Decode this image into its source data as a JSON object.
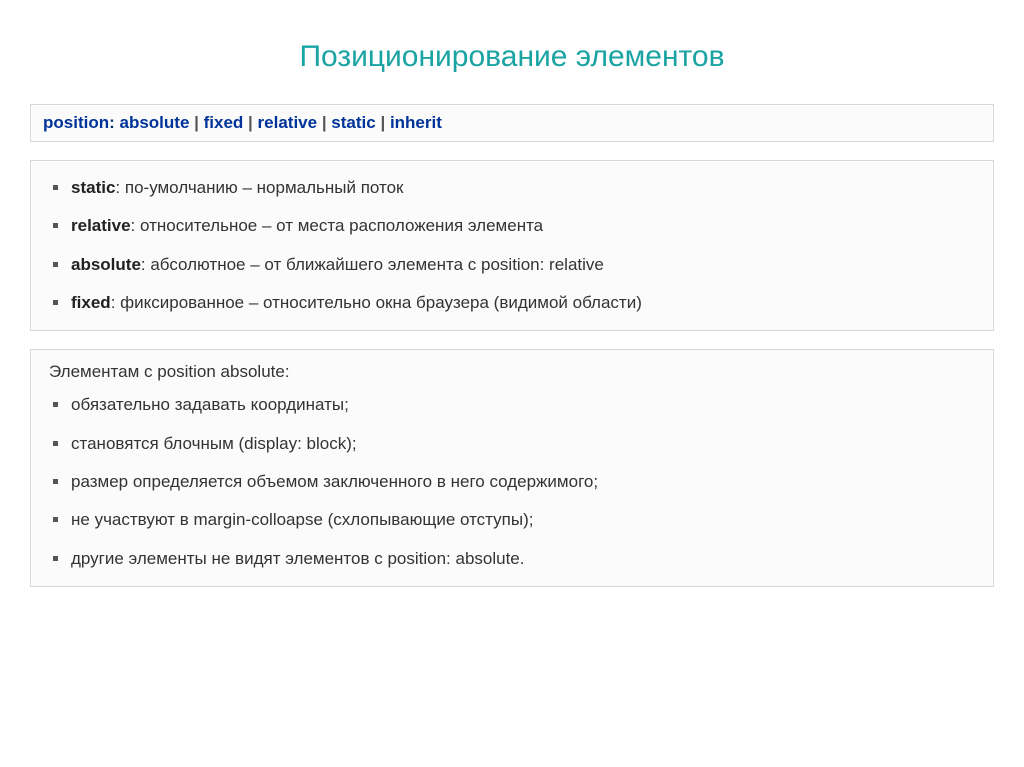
{
  "title": "Позиционирование элементов",
  "syntax": {
    "property": "position",
    "values": [
      "absolute",
      "fixed",
      "relative",
      "static",
      "inherit"
    ]
  },
  "definitions": [
    {
      "term": "static",
      "desc": ": по-умолчанию – нормальный поток"
    },
    {
      "term": "relative",
      "desc": ": относительное – от места расположения элемента"
    },
    {
      "term": "absolute",
      "desc": ": абсолютное – от ближайшего элемента с position: relative"
    },
    {
      "term": "fixed",
      "desc": ": фиксированное – относительно окна браузера (видимой области)"
    }
  ],
  "notes": {
    "intro": "Элементам с position absolute:",
    "items": [
      "обязательно задавать координаты;",
      "становятся блочным (display: block);",
      "размер определяется объемом заключенного в него содержимого;",
      "не участвуют в margin-colloapse (схлопывающие отступы);",
      "другие элементы не видят элементов с position: absolute."
    ]
  }
}
